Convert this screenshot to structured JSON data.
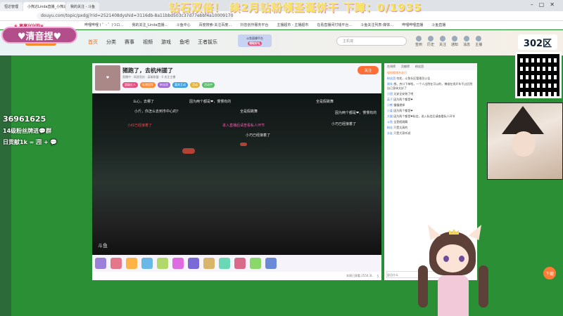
{
  "browser": {
    "tabs": [
      "恒达管理",
      "小熊达Linda直播_小熊达Linda在…",
      "我的关注 - 斗鱼"
    ],
    "url": "douyu.com/topic/pxdgj?rid=2521408dyshid=3116db-8a11bbd503c37d77ebbf4a100091701",
    "bookmarks": [
      "哔哩哔哩 ( ゜- ゜)つロ…",
      "我的关注_Linda直播…",
      "斗鱼中心",
      "百度搜索-关注百度…",
      "抖音创作服务平台",
      "主播超市 - 主播超市",
      "在看直播间付钱平台…",
      "斗鱼关注列表-媒体…",
      "哔哩哔哩直播",
      "斗鱼直播"
    ]
  },
  "site": {
    "nav": [
      "首页",
      "分类",
      "赛事",
      "视频",
      "游戏",
      "鱼吧",
      "王者拔乐"
    ],
    "banner_top": "斗鱼直播平台",
    "banner_btn": "领取好礼",
    "search_placeholder": "主机端",
    "header_icons": [
      "签到",
      "历史",
      "关注",
      "通知",
      "消息",
      "主播"
    ]
  },
  "room": {
    "title": "猪跑了，去杭州搓了",
    "meta": "直播中 · 网游竞技 · 英雄联盟 · 0 关注主播",
    "tags": [
      "超级红人",
      "礼物冠军",
      "粉丝团",
      "嘉宾互动",
      "活动",
      "活动中"
    ],
    "follow": "关注",
    "watermark": "斗鱼"
  },
  "danmaku": [
    "么心，去哪了",
    "小斤，你怎么去到市中心的？",
    "因为两个都是❤，慢慢有的",
    "全是假跳舞",
    "小红已经接着了",
    "因为两个都是❤，慢慢有的",
    "小巧已经接着了",
    "进入直播后请查看私人环节",
    "全是假跳舞",
    "小巧已经接着了"
  ],
  "chat": {
    "tabs": [
      "在线榜",
      "贡献榜",
      "粉丝团"
    ],
    "notice": "轻短相领台念日",
    "lines": [
      {
        "nick": "粉丝团",
        "text": "勿扰，斗鱼社区管理员公告"
      },
      {
        "nick": "周年",
        "text": "想。杰口下单啦，一个人出院在可以的，博维在线开车不过后院自己身体太好了"
      },
      {
        "nick": "小团",
        "text": "太安全安装了吧"
      },
      {
        "nick": "英子",
        "text": "因为两个都是❤"
      },
      {
        "nick": "小熊",
        "text": "慢慢熄掉"
      },
      {
        "nick": "小爱",
        "text": "因为两个都是❤"
      },
      {
        "nick": "大猫",
        "text": "因为两个都是❤私信，进入私信后请查看私人环节"
      },
      {
        "nick": "斗鱼",
        "text": "全是假跳舞"
      },
      {
        "nick": "粉丝",
        "text": "只是太高的"
      },
      {
        "nick": "水友",
        "text": "只是大家听说"
      }
    ],
    "input_placeholder": "说点什么"
  },
  "overlay": {
    "top_banner": "钻石双倍！ 续2月钻粉领圣诞饼干 下蹲：0/1935",
    "streamer_name": "♥清音捏♥",
    "subtitle": "❀ 高高兴兴的❀",
    "stats_count": "36961625",
    "stats_line2": "14级粉丝牌进💬群",
    "stats_line3": "日贡献1k = 🈷 + 💬",
    "badge": "302区",
    "float_btn": "下载"
  },
  "player": {
    "footer_left": "本周已观看 2554.3L",
    "footer_right": "5"
  },
  "colors": {
    "accent": "#f46e20",
    "background_green": "#2a8f35",
    "name_pink": "#b24f8a",
    "banner_yellow": "#f6e35a"
  }
}
